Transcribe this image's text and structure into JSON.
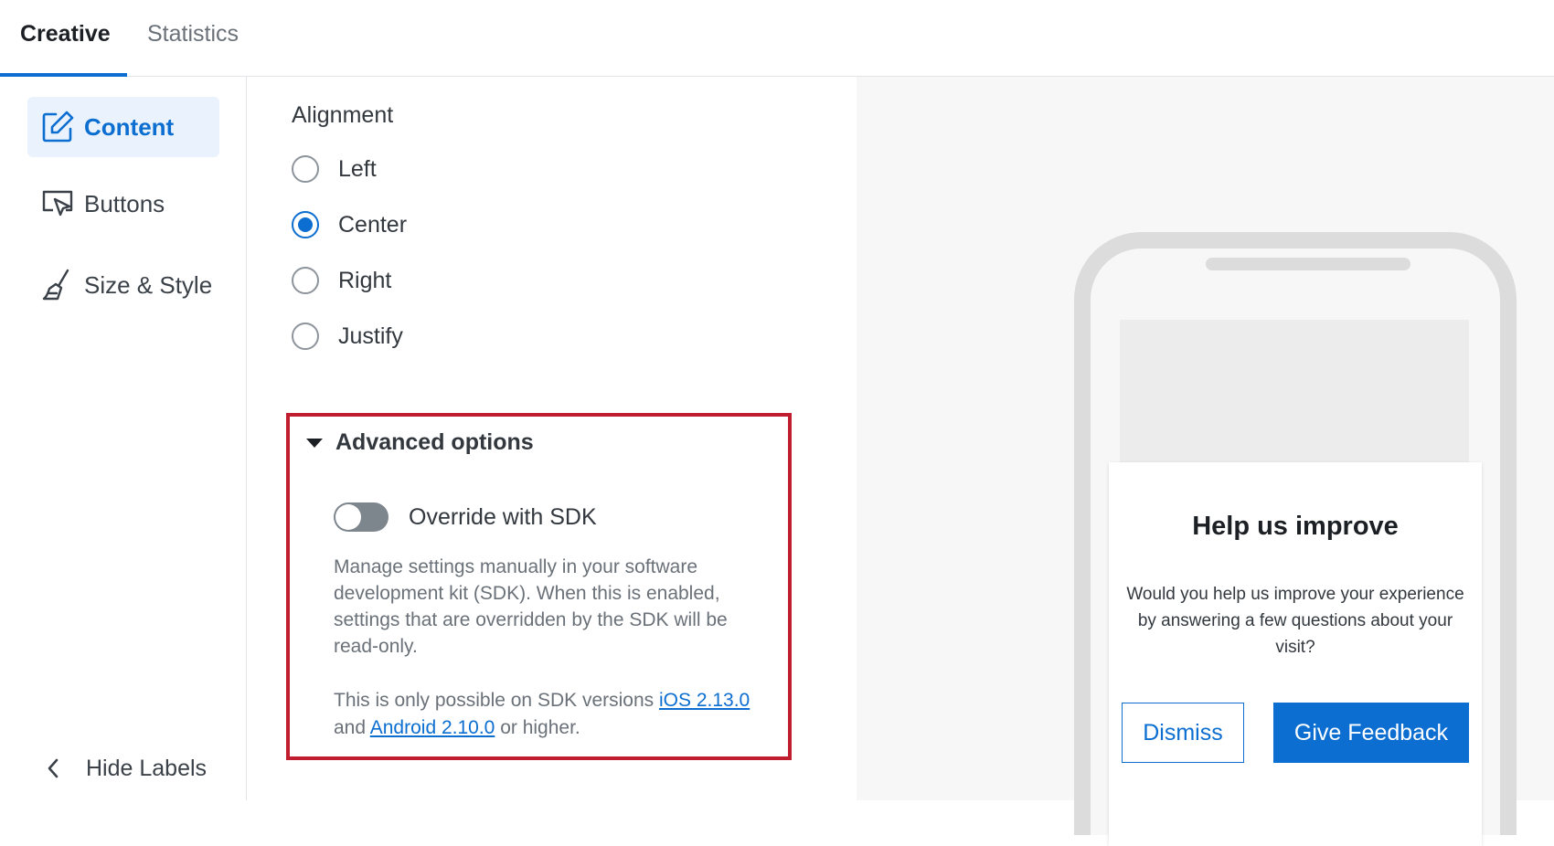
{
  "tabs": [
    {
      "label": "Creative",
      "active": true
    },
    {
      "label": "Statistics",
      "active": false
    }
  ],
  "sidebar": {
    "items": [
      {
        "label": "Content",
        "icon": "edit-icon",
        "active": true
      },
      {
        "label": "Buttons",
        "icon": "cursor-click-icon",
        "active": false
      },
      {
        "label": "Size & Style",
        "icon": "brush-icon",
        "active": false
      }
    ],
    "hide_labels": "Hide Labels"
  },
  "alignment": {
    "heading": "Alignment",
    "options": [
      {
        "label": "Left",
        "checked": false
      },
      {
        "label": "Center",
        "checked": true
      },
      {
        "label": "Right",
        "checked": false
      },
      {
        "label": "Justify",
        "checked": false
      }
    ]
  },
  "advanced": {
    "title": "Advanced options",
    "expanded": true,
    "toggle_label": "Override with SDK",
    "toggle_on": false,
    "description": "Manage settings manually in your software development kit (SDK). When this is enabled, settings that are overridden by the SDK will be read-only.",
    "note_prefix": "This is only possible on SDK versions",
    "ios_link": "iOS 2.13.0",
    "note_and": "and",
    "android_link": "Android 2.10.0",
    "note_suffix": "or higher."
  },
  "preview": {
    "title": "Help us improve",
    "body": "Would you help us improve your experience by answering a few questions about your visit?",
    "dismiss_label": "Dismiss",
    "feedback_label": "Give Feedback"
  },
  "colors": {
    "accent": "#0b6ed0",
    "highlight_border": "#c01d2e",
    "active_nav_bg": "#eaf3fd"
  }
}
